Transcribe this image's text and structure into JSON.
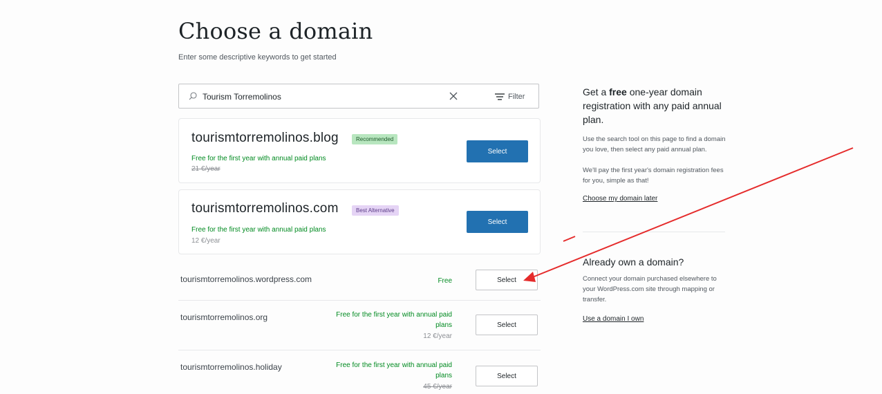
{
  "header": {
    "title": "Choose a domain",
    "subtitle": "Enter some descriptive keywords to get started"
  },
  "search": {
    "value": "Tourism Torremolinos",
    "filter_label": "Filter"
  },
  "featured": [
    {
      "domain": "tourismtorremolinos.blog",
      "badge": "Recommended",
      "free_text": "Free for the first year with annual paid plans",
      "price": "21 €/year",
      "button": "Select"
    },
    {
      "domain": "tourismtorremolinos.com",
      "badge": "Best Alternative",
      "free_text": "Free for the first year with annual paid plans",
      "price": "12 €/year",
      "button": "Select"
    }
  ],
  "results": [
    {
      "domain": "tourismtorremolinos.wordpress.com",
      "free_text": "Free",
      "price": "",
      "button": "Select"
    },
    {
      "domain": "tourismtorremolinos.org",
      "free_text": "Free for the first year with annual paid plans",
      "price": "12 €/year",
      "button": "Select"
    },
    {
      "domain": "tourismtorremolinos.holiday",
      "free_text": "Free for the first year with annual paid plans",
      "price": "45 €/year",
      "button": "Select"
    }
  ],
  "sidebar": {
    "promo": {
      "title_pre": "Get a ",
      "title_bold": "free",
      "title_post": " one-year domain registration with any paid annual plan.",
      "p1": "Use the search tool on this page to find a domain you love, then select any paid annual plan.",
      "p2": "We'll pay the first year's domain registration fees for you, simple as that!",
      "link": "Choose my domain later"
    },
    "own": {
      "title": "Already own a domain?",
      "text": "Connect your domain purchased elsewhere to your WordPress.com site through mapping or transfer.",
      "link": "Use a domain I own"
    }
  },
  "colors": {
    "primary": "#2271b1",
    "free_text": "#008a20",
    "annotation": "#e52b2b"
  }
}
